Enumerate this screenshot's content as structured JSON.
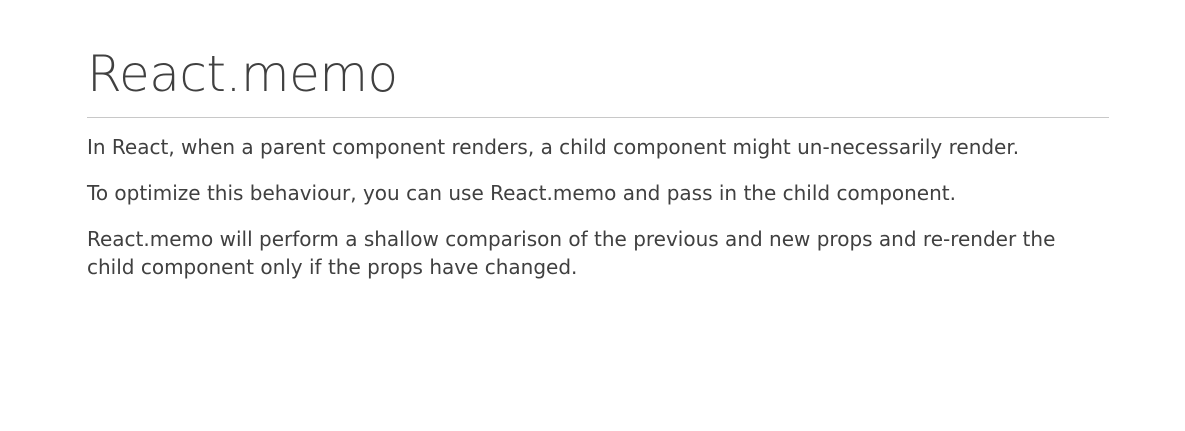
{
  "slide": {
    "title": "React.memo",
    "paragraphs": [
      "In React, when a parent component renders, a child component might un-necessarily render.",
      "To optimize this behaviour, you can use React.memo and pass in the child component.",
      "React.memo will perform a shallow comparison of the previous and new props and re-render the child component only if the props have changed."
    ]
  }
}
